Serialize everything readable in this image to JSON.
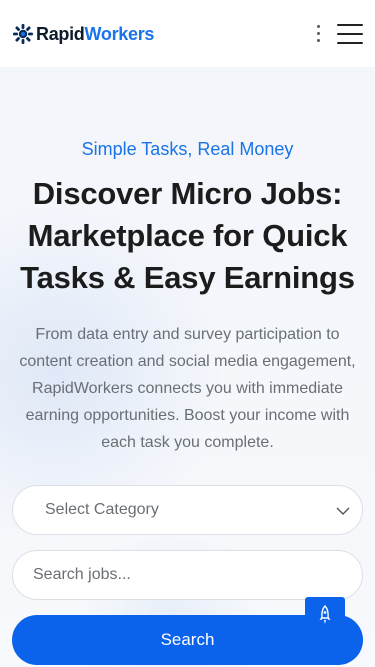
{
  "header": {
    "logo_primary": "Rapid",
    "logo_secondary": "Workers",
    "logo_icon": "gear-icon",
    "more_icon": "kebab-icon",
    "menu_icon": "hamburger-icon"
  },
  "hero": {
    "tagline": "Simple Tasks, Real Money",
    "title": "Discover Micro Jobs: Marketplace for Quick Tasks & Easy Earnings",
    "description": "From data entry and survey participation to content creation and social media engagement, RapidWorkers connects you with immediate earning opportunities. Boost your income with each task you complete."
  },
  "search": {
    "category_selected": "Select Category",
    "input_placeholder": "Search jobs...",
    "button_label": "Search"
  },
  "floating": {
    "icon": "rocket-icon"
  },
  "colors": {
    "accent": "#1a73e8",
    "button": "#0a63ea",
    "heading": "#1c1c1c",
    "body_text": "#6a6f75",
    "hero_bg": "#f4f6fa"
  }
}
